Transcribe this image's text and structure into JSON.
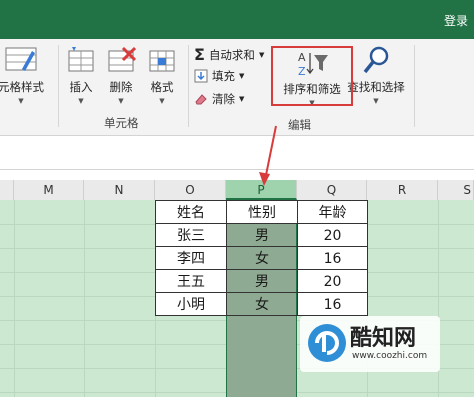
{
  "header": {
    "login_label": "登录"
  },
  "ribbon": {
    "cell_styles_label": "元格样式",
    "insert_label": "插入",
    "delete_label": "删除",
    "format_label": "格式",
    "cells_group_label": "单元格",
    "autosum_label": "自动求和",
    "fill_label": "填充",
    "clear_label": "清除",
    "sort_filter_label": "排序和筛选",
    "find_select_label": "查找和选择",
    "editing_group_label": "编辑"
  },
  "columns": [
    "M",
    "N",
    "O",
    "P",
    "Q",
    "R",
    "S"
  ],
  "selected_column": "P",
  "table": {
    "headers": [
      "姓名",
      "性别",
      "年龄"
    ],
    "rows": [
      [
        "张三",
        "男",
        "20"
      ],
      [
        "李四",
        "女",
        "16"
      ],
      [
        "王五",
        "男",
        "20"
      ],
      [
        "小明",
        "女",
        "16"
      ]
    ]
  },
  "watermark": {
    "name": "酷知网",
    "url": "www.coozhi.com"
  },
  "colors": {
    "excel_green": "#217346",
    "highlight_red": "#d83b3b",
    "grid_green": "#cce8d0"
  }
}
